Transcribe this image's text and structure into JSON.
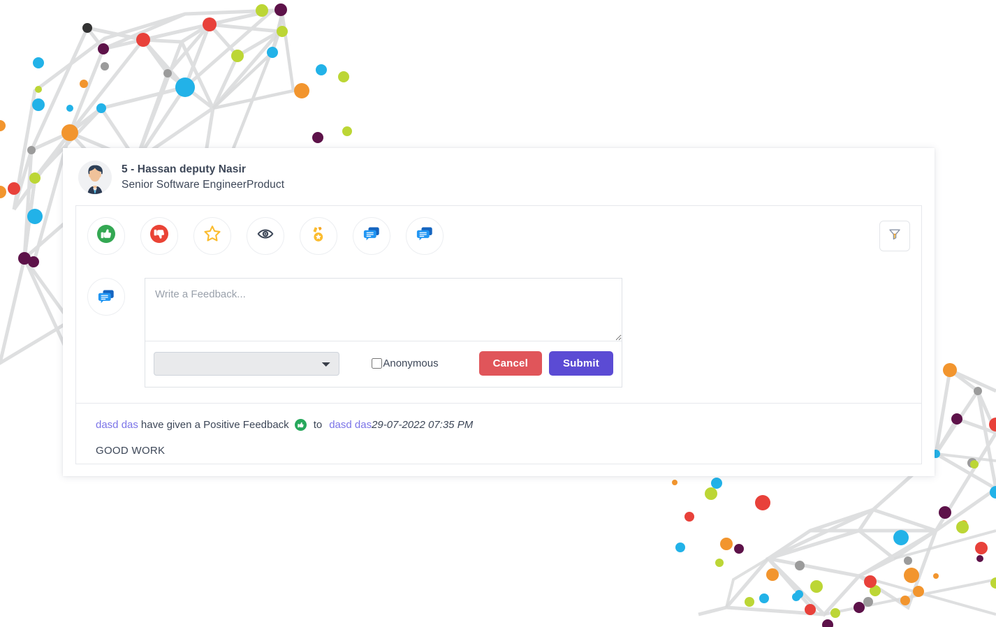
{
  "profile": {
    "avatar_icon": "user-avatar-icon",
    "name": "5 - Hassan deputy Nasir",
    "role": "Senior Software EngineerProduct"
  },
  "toolbar": {
    "reactions": [
      {
        "id": "positive",
        "icon": "thumbs-up-icon",
        "label": "Positive Feedback",
        "color": "#34a853"
      },
      {
        "id": "negative",
        "icon": "thumbs-down-icon",
        "label": "Negative Feedback",
        "color": "#ea4335"
      },
      {
        "id": "star",
        "icon": "star-icon",
        "label": "Star",
        "color": "#fbbc2e"
      },
      {
        "id": "observe",
        "icon": "eye-icon",
        "label": "Observation",
        "color": "#3d4758"
      },
      {
        "id": "award",
        "icon": "medal-icon",
        "label": "Award",
        "color": "#fbbc2e"
      },
      {
        "id": "comment",
        "icon": "comment-icon",
        "label": "Comment",
        "color": "#1a8cf0"
      },
      {
        "id": "feedback",
        "icon": "comments-icon",
        "label": "Feedback",
        "color": "#1a8cf0"
      }
    ],
    "filter": {
      "icon": "filter-icon",
      "label": "Filter"
    }
  },
  "compose": {
    "avatar_icon": "comments-icon",
    "placeholder": "Write a Feedback...",
    "value": "",
    "type_select": {
      "value": "",
      "options": [
        ""
      ]
    },
    "anonymous": {
      "label": "Anonymous",
      "checked": false
    },
    "cancel_label": "Cancel",
    "submit_label": "Submit"
  },
  "feed": [
    {
      "actor": "dasd das",
      "action": "have given a Positive Feedback",
      "badge_icon": "thumbs-up-badge-icon",
      "to_label": "to",
      "target": "dasd das",
      "timestamp": "29-07-2022 07:35 PM",
      "body": "GOOD WORK"
    }
  ],
  "colors": {
    "accent_submit": "#5b4bd4",
    "accent_cancel": "#e0555a",
    "link": "#7b74e8",
    "text": "#3d4758",
    "positive": "#34a853",
    "negative": "#ea4335",
    "star": "#fbbc2e",
    "comment_blue": "#1a8cf0"
  }
}
